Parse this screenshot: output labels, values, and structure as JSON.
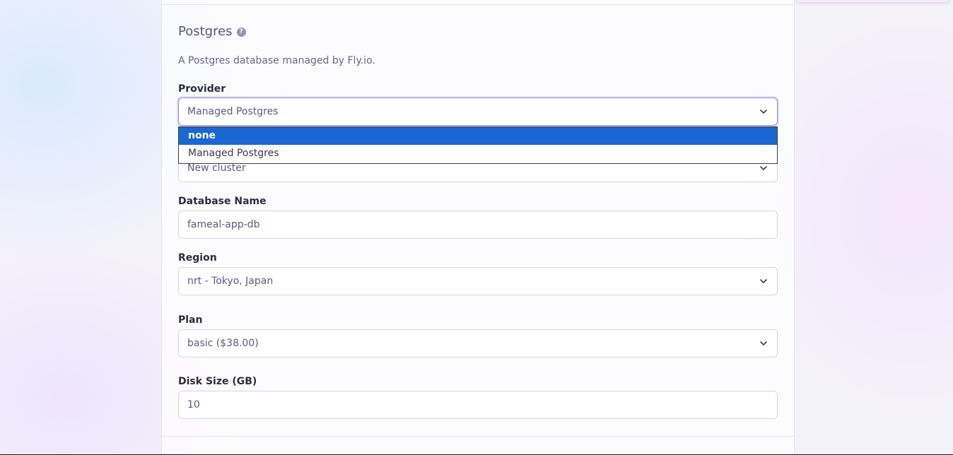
{
  "section": {
    "title": "Postgres",
    "help_icon": "question-circle-icon",
    "description": "A Postgres database managed by Fly.io."
  },
  "fields": {
    "provider": {
      "label": "Provider",
      "value": "Managed Postgres",
      "options": [
        "none",
        "Managed Postgres"
      ],
      "highlighted_option": "none"
    },
    "cluster": {
      "value": "New cluster"
    },
    "database_name": {
      "label": "Database Name",
      "value": "fameal-app-db"
    },
    "region": {
      "label": "Region",
      "value": "nrt - Tokyo, Japan"
    },
    "plan": {
      "label": "Plan",
      "value": "basic ($38.00)"
    },
    "disk_size": {
      "label": "Disk Size (GB)",
      "value": "10"
    }
  },
  "colors": {
    "highlight": "#1a67d2",
    "focus_border": "#9b86d6",
    "label_text": "#2e2a3e",
    "value_text": "#5e5880"
  }
}
